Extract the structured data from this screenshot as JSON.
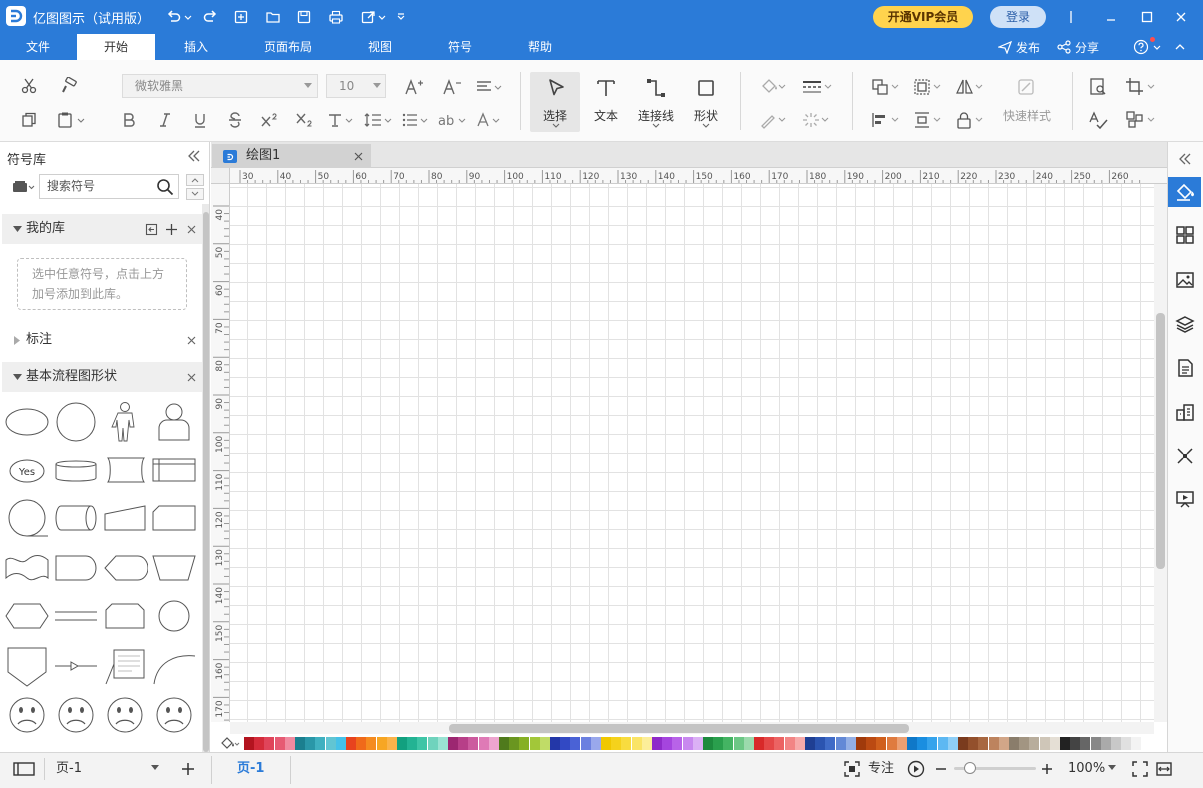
{
  "app": {
    "title": "亿图图示（试用版）",
    "vip_label": "开通VIP会员",
    "login_label": "登录"
  },
  "menu": {
    "items": [
      "文件",
      "开始",
      "插入",
      "页面布局",
      "视图",
      "符号",
      "帮助"
    ],
    "active": "开始",
    "publish": "发布",
    "share": "分享"
  },
  "ribbon": {
    "font_name": "微软雅黑",
    "font_size": "10",
    "select": "选择",
    "text": "文本",
    "connector": "连接线",
    "shape": "形状",
    "quick_style": "快速样式"
  },
  "symbol_lib": {
    "title": "符号库",
    "search_placeholder": "搜索符号",
    "my_lib": "我的库",
    "my_lib_hint_1": "选中任意符号，点击上方",
    "my_lib_hint_2": "加号添加到此库。",
    "annotation": "标注",
    "flowchart": "基本流程图形状",
    "yes_label": "Yes"
  },
  "document": {
    "tab_title": "绘图1"
  },
  "rulers": {
    "h_ticks": [
      "30",
      "40",
      "50",
      "60",
      "70",
      "80",
      "90",
      "100",
      "110",
      "120",
      "130",
      "140",
      "150",
      "160",
      "170",
      "180",
      "190",
      "200",
      "210",
      "220",
      "230",
      "240",
      "250",
      "260"
    ],
    "v_ticks": [
      "40",
      "50",
      "60",
      "70",
      "80",
      "90",
      "100",
      "110",
      "120",
      "130",
      "140",
      "150",
      "160",
      "170"
    ]
  },
  "palette": [
    "#b3141f",
    "#d42b3a",
    "#e0445a",
    "#e65a73",
    "#f08aa0",
    "#1b7f8f",
    "#2a97a8",
    "#3fb0c0",
    "#61c5d3",
    "#45c1e8",
    "#e8431e",
    "#f06a1a",
    "#f58b1f",
    "#f7a623",
    "#fbb34a",
    "#12a07f",
    "#23b393",
    "#3ec5a6",
    "#6fd3bd",
    "#9ae3d3",
    "#9c2771",
    "#b73f88",
    "#cc5a9e",
    "#df7ab6",
    "#eea5cf",
    "#4f7a1c",
    "#6a9620",
    "#86b024",
    "#a2c739",
    "#c0dc67",
    "#2337a8",
    "#3249c4",
    "#4a62d6",
    "#6b80e0",
    "#99a8ec",
    "#f0c800",
    "#f5d21c",
    "#f8dc3f",
    "#fae466",
    "#fcee99",
    "#8f2bc9",
    "#a545de",
    "#b863e8",
    "#c888ef",
    "#dbb0f5",
    "#1d8a3e",
    "#2a9f4d",
    "#44b463",
    "#6cc785",
    "#9bdaac",
    "#d82929",
    "#e44747",
    "#ec6363",
    "#f28585",
    "#f7aaaa",
    "#1f3f93",
    "#2b54b0",
    "#3f6bc7",
    "#6389d6",
    "#93afe5",
    "#a03a0b",
    "#bb4a12",
    "#d05f1c",
    "#df7b3f",
    "#ec9f72",
    "#0f78c8",
    "#1a8ee0",
    "#35a3ec",
    "#5db8f2",
    "#8fcff7",
    "#7a3b1e",
    "#93502c",
    "#a86740",
    "#bd835e",
    "#d2a688",
    "#8a7d6b",
    "#a29582",
    "#b8ad9c",
    "#cfc6b8",
    "#e5dfd5",
    "#222222",
    "#444444",
    "#666666",
    "#888888",
    "#aaaaaa",
    "#c8c8c8",
    "#e0e0e0",
    "#f3f3f3"
  ],
  "status": {
    "page_select": "页-1",
    "page_tab": "页-1",
    "focus": "专注",
    "zoom": "100%",
    "zoom_level": 0.2
  }
}
